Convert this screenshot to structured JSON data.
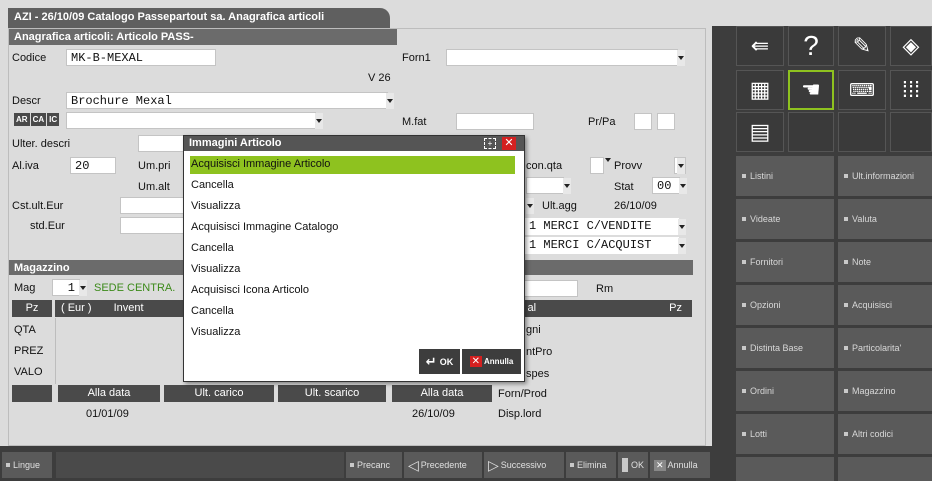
{
  "window_title": "AZI - 26/10/09  Catalogo Passepartout sa.  Anagrafica articoli",
  "form": {
    "header": "Anagrafica articoli: Articolo  PASS-",
    "codice_label": "Codice",
    "codice_value": "MK-B-MEXAL",
    "forn1_label": "Forn1",
    "version": "V 26",
    "descr_label": "Descr",
    "descr_value": "Brochure Mexal",
    "lang_buttons": [
      "AR",
      "CA",
      "IC"
    ],
    "mfat_label": "M.fat",
    "prpa_label": "Pr/Pa",
    "ulter_label": "Ulter. descri",
    "aliva_label": "Al.iva",
    "aliva_value": "20",
    "umpri_label": "Um.pri",
    "umalt_label": "Um.alt",
    "conqta_label": "con.qta",
    "provv_label": "Provv",
    "stat_label": "Stat",
    "stat_value": "00",
    "cstult_label": "Cst.ult.Eur",
    "std_label": "std.Eur",
    "ultagg_label": "Ult.agg",
    "ultagg_value": "26/10/09",
    "conto_vendite": "1  MERCI C/VENDITE",
    "conto_acquisti": "1  MERCI C/ACQUIST"
  },
  "magazzino": {
    "header": "Magazzino",
    "mag_label": "Mag",
    "mag_value": "1",
    "mag_name": "SEDE CENTRA.",
    "rm_label": "Rm",
    "col_pz": "Pz",
    "col_eur": "( Eur )",
    "col_invent": "Invent",
    "col_al": "i al",
    "col_pz2": "Pz",
    "rows": [
      "QTA",
      "PREZ",
      "VALO"
    ],
    "right_rows": [
      "gni",
      "ntPro",
      "spes"
    ],
    "btn_alla_data_1": "Alla data",
    "btn_ult_carico": "Ult. carico",
    "btn_ult_scarico": "Ult. scarico",
    "btn_alla_data_2": "Alla data",
    "date_1": "01/01/09",
    "date_2": "26/10/09",
    "forn_prod": "Forn/Prod",
    "disp_lord": "Disp.lord"
  },
  "dialog": {
    "title": "Immagini Articolo",
    "items": [
      "Acquisisci Immagine Articolo",
      "Cancella",
      "Visualizza",
      "Acquisisci Immagine Catalogo",
      "Cancella",
      "Visualizza",
      "Acquisisci Icona Articolo",
      "Cancella",
      "Visualizza"
    ],
    "selected_index": 0,
    "ok_label": "OK",
    "annulla_label": "Annulla"
  },
  "right_panel": {
    "icons": [
      "mail-fold-icon",
      "help-icon",
      "edit-note-icon",
      "cube-icon",
      "calculator-icon",
      "touch-icon",
      "keyboard-icon",
      "grid-icon",
      "report-icon"
    ],
    "help_glyph": "?",
    "buttons_left": [
      "Listini",
      "Videate",
      "Fornitori",
      "Opzioni",
      "Distinta Base",
      "Ordini",
      "Lotti"
    ],
    "buttons_right": [
      "Ult.informazioni",
      "Valuta",
      "Note",
      "Acquisisci",
      "Particolarita'",
      "Magazzino",
      "Altri codici"
    ]
  },
  "bottom_bar": {
    "lingue": "Lingue",
    "precanc": "Precanc",
    "precedente": "Precedente",
    "successivo": "Successivo",
    "elimina": "Elimina",
    "ok": "OK",
    "annulla": "Annulla"
  },
  "colors": {
    "selected_item": "#8ec21f",
    "panel_dark": "#3d3d3d",
    "button_gray": "#5a5a5a",
    "header_gray": "#6b6b6b",
    "close_red": "#d42020"
  }
}
